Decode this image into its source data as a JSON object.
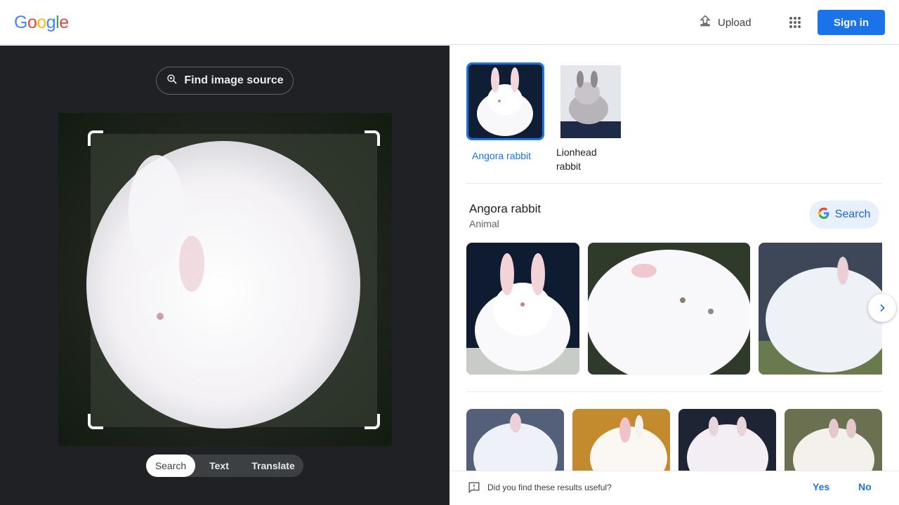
{
  "header": {
    "logo_letters": [
      {
        "ch": "G",
        "color": "#4285F4"
      },
      {
        "ch": "o",
        "color": "#EA4335"
      },
      {
        "ch": "o",
        "color": "#FBBC05"
      },
      {
        "ch": "g",
        "color": "#4285F4"
      },
      {
        "ch": "l",
        "color": "#34A853"
      },
      {
        "ch": "e",
        "color": "#EA4335"
      }
    ],
    "upload_label": "Upload",
    "signin_label": "Sign in"
  },
  "left_pane": {
    "find_source_label": "Find image source",
    "modes": [
      "Search",
      "Text",
      "Translate"
    ],
    "active_mode": "Search"
  },
  "right_pane": {
    "visual_matches": [
      {
        "label": "Angora rabbit",
        "selected": true
      },
      {
        "label": "Lionhead rabbit",
        "selected": false
      }
    ],
    "entity": {
      "title": "Angora rabbit",
      "subtitle": "Animal",
      "search_label": "Search"
    },
    "feedback": {
      "question": "Did you find these results useful?",
      "yes_label": "Yes",
      "no_label": "No"
    }
  },
  "colors": {
    "accent": "#1a73e8",
    "dark_pane": "#202124",
    "selected_border": "#1a73e8"
  }
}
